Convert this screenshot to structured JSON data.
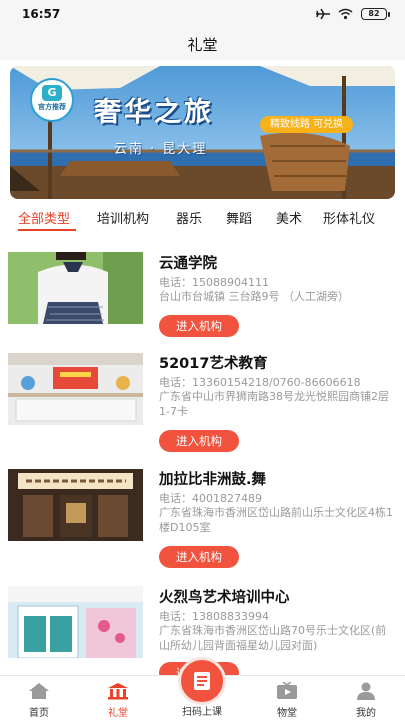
{
  "status_bar": {
    "time": "16:57",
    "battery": "82"
  },
  "header": {
    "title": "礼堂"
  },
  "banner": {
    "badge": "官方推荐",
    "title": "奢华之旅",
    "subtitle": "云南 · 昆大理",
    "tag": "精致线路 可兑换"
  },
  "tabs": [
    {
      "label": "全部类型",
      "active": true
    },
    {
      "label": "培训机构",
      "active": false
    },
    {
      "label": "器乐",
      "active": false
    },
    {
      "label": "舞蹈",
      "active": false
    },
    {
      "label": "美术",
      "active": false
    },
    {
      "label": "形体礼仪",
      "active": false
    }
  ],
  "institutions": [
    {
      "name": "云通学院",
      "phone": "电话：15088904111",
      "address": "台山市台城镇 三台路9号 （人工湖旁）",
      "button": "进入机构"
    },
    {
      "name": "52017艺术教育",
      "phone": "电话：13360154218/0760-86606618",
      "address": "广东省中山市界狮南路38号龙光悦熙园商铺2层1-7卡",
      "button": "进入机构"
    },
    {
      "name": "加拉比非洲鼓.舞",
      "phone": "电话：4001827489",
      "address": "广东省珠海市香洲区岱山路前山乐士文化区4栋1楼D105室",
      "button": "进入机构"
    },
    {
      "name": "火烈鸟艺术培训中心",
      "phone": "电话：13808833994",
      "address": "广东省珠海市香洲区岱山路70号乐士文化区(前山所幼儿园背面福星幼儿园对面)",
      "button": "进入机构"
    }
  ],
  "bottom_nav": {
    "home": "首页",
    "hall": "礼堂",
    "scan": "扫码上课",
    "store": "物堂",
    "mine": "我的"
  },
  "colors": {
    "accent": "#e8432a",
    "button": "#f2533e"
  }
}
